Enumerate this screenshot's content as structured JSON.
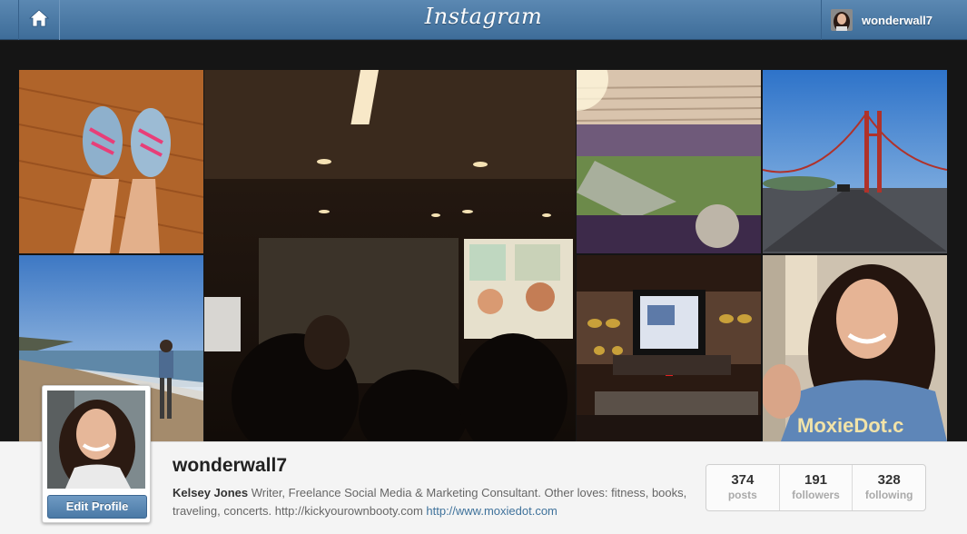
{
  "header": {
    "logo_text": "Instagram",
    "username": "wonderwall7"
  },
  "photos": [
    {
      "subject": "sneakers on wood floor"
    },
    {
      "subject": "conference room presentation"
    },
    {
      "subject": "football stadium"
    },
    {
      "subject": "golden gate bridge"
    },
    {
      "subject": "beach walk"
    },
    {
      "subject": "treadmill screen"
    },
    {
      "subject": "selfie in moxiedot shirt"
    }
  ],
  "profile": {
    "username": "wonderwall7",
    "edit_label": "Edit Profile",
    "bio_name": "Kelsey Jones",
    "bio_text": " Writer, Freelance Social Media & Marketing Consultant. Other loves: fitness, books, traveling, concerts. http://kickyourownbooty.com ",
    "bio_link": "http://www.moxiedot.com"
  },
  "stats": [
    {
      "value": "374",
      "label": "posts"
    },
    {
      "value": "191",
      "label": "followers"
    },
    {
      "value": "328",
      "label": "following"
    }
  ],
  "colors": {
    "topbar": "#4a7aa6",
    "link": "#3f729b",
    "page_bg": "#f4f4f4"
  }
}
